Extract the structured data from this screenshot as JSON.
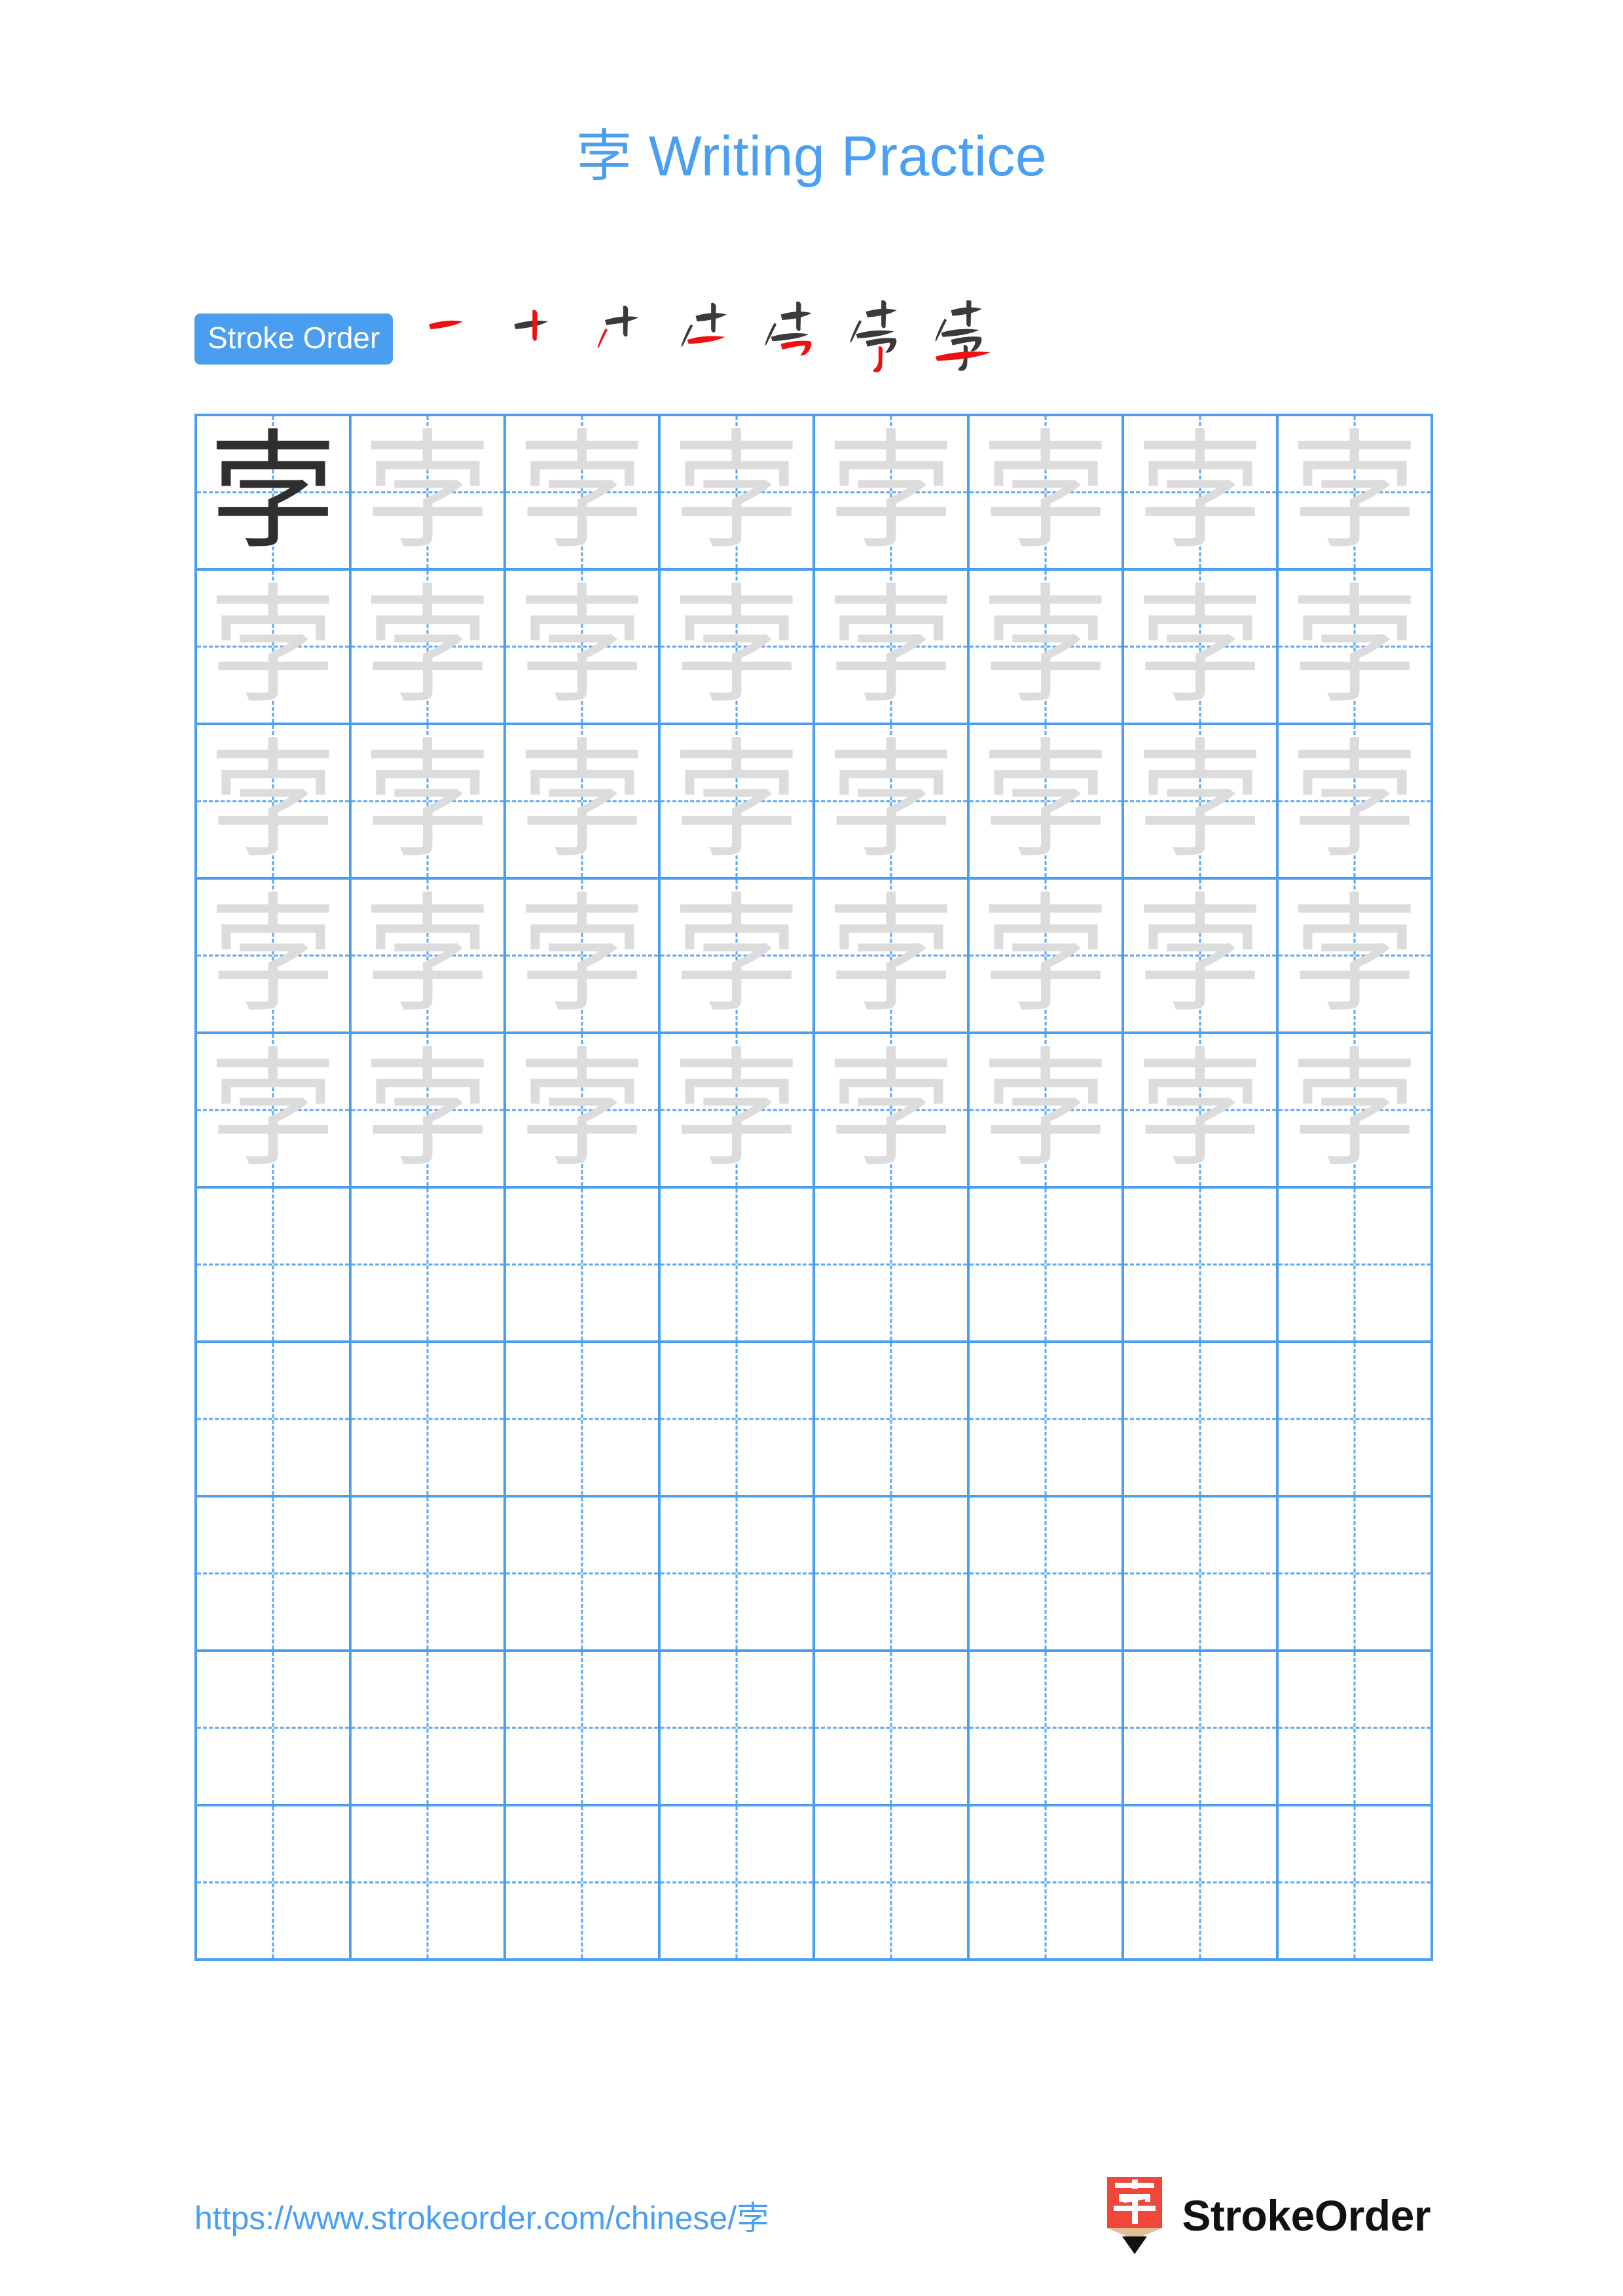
{
  "page": {
    "character": "孛",
    "title_suffix": " Writing Practice",
    "title_full": "孛 Writing Practice",
    "background_color": "#ffffff",
    "accent_color": "#4a9ef0",
    "title_color": "#4a9ff2",
    "guide_glyph_color": "#dcdcdc",
    "dark_glyph_color": "#2f2f2f",
    "new_stroke_color": "#ee1111",
    "prior_stroke_color": "#3a3a3a"
  },
  "stroke_order": {
    "badge_label": "Stroke Order",
    "total_strokes": 7,
    "steps": [
      {
        "index": 1,
        "label": "一",
        "new_stroke": "heng"
      },
      {
        "index": 2,
        "label": "十",
        "new_stroke": "shu"
      },
      {
        "index": 3,
        "label": "𠂇",
        "new_stroke": "pie"
      },
      {
        "index": 4,
        "label": "屮",
        "new_stroke": "heng"
      },
      {
        "index": 5,
        "label": "㞢",
        "new_stroke": "henggou"
      },
      {
        "index": 6,
        "label": "孛",
        "new_stroke": "shugou"
      },
      {
        "index": 7,
        "label": "孛",
        "new_stroke": "heng"
      }
    ]
  },
  "grid": {
    "columns": 8,
    "rows": 10,
    "cell_size_px": 236,
    "filled_rows": 5,
    "model_cell": {
      "row": 1,
      "column": 1,
      "style": "dark"
    },
    "guide_style": "light",
    "empty_rows": [
      6,
      7,
      8,
      9,
      10
    ]
  },
  "footer": {
    "url": "https://www.strokeorder.com/chinese/孛",
    "brand_name": "StrokeOrder",
    "brand_mark_character": "字",
    "brand_mark_color": "#f0463c",
    "brand_mark_wood_color": "#e3bd94"
  }
}
